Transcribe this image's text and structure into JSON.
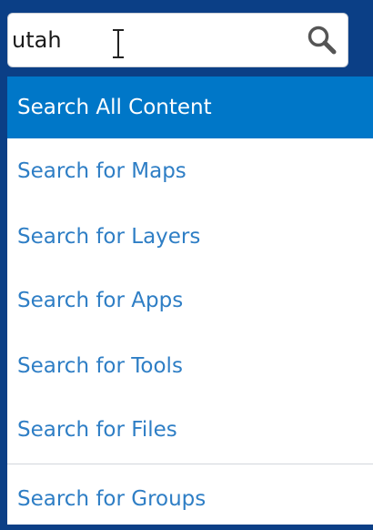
{
  "search": {
    "value": "utah",
    "icon": "search-icon"
  },
  "menu": {
    "items": [
      {
        "label": "Search All Content",
        "active": true
      },
      {
        "label": "Search for Maps"
      },
      {
        "label": "Search for Layers"
      },
      {
        "label": "Search for Apps"
      },
      {
        "label": "Search for Tools"
      },
      {
        "label": "Search for Files"
      },
      {
        "label": "Search for Groups"
      }
    ]
  },
  "colors": {
    "background": "#0b3f86",
    "active_item": "#0077c8",
    "link_text": "#2e7ec5"
  }
}
